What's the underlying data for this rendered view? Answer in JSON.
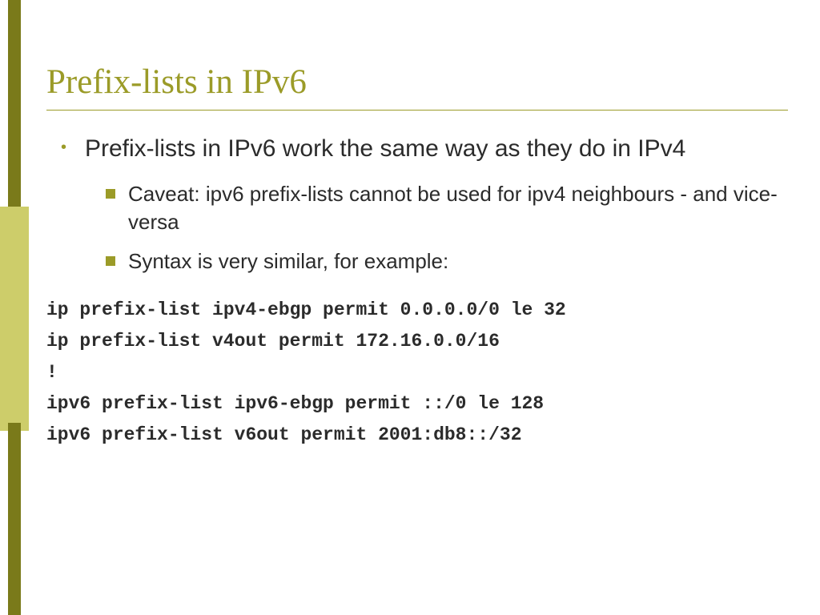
{
  "title": "Prefix-lists in IPv6",
  "bullets": [
    "Prefix-lists in IPv6 work the same way as they do in IPv4"
  ],
  "sub_bullets": [
    "Caveat: ipv6 prefix-lists cannot be used for ipv4 neighbours - and vice-versa",
    "Syntax is very similar, for example:"
  ],
  "code": [
    "ip prefix-list ipv4-ebgp permit 0.0.0.0/0 le 32",
    "ip prefix-list v4out permit 172.16.0.0/16",
    "!",
    "ipv6 prefix-list ipv6-ebgp permit ::/0 le 128",
    "ipv6 prefix-list v6out permit 2001:db8::/32"
  ]
}
